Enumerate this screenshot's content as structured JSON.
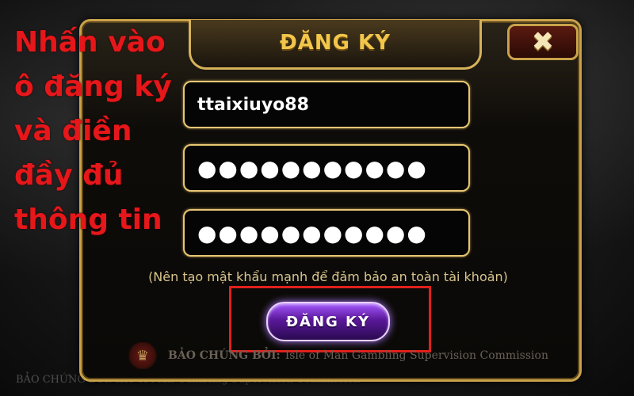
{
  "modal": {
    "title": "ĐĂNG KÝ",
    "close_icon": "close-icon"
  },
  "form": {
    "username_value": "ttaixiuyo88",
    "password_mask": "●●●●●●●●●●●",
    "confirm_mask": "●●●●●●●●●●●",
    "hint": "(Nên tạo mật khẩu mạnh để đảm bảo an toàn tài khoản)",
    "submit_label": "ĐĂNG KÝ"
  },
  "footer": {
    "brand": "BẢO CHỨNG BỞI:",
    "commission": "Isle of Man Gambling Supervision Commission"
  },
  "background": {
    "bottom_text": "BẢO CHỨNG BỞI: Isle of Man Gambling Supervision Commission"
  },
  "annotation": {
    "lines": [
      "Nhấn vào",
      "ô đăng ký",
      "và điền",
      "đầy đủ",
      "thông tin"
    ],
    "highlight_color": "#e0201c"
  },
  "colors": {
    "gold": "#c9a24a",
    "title": "#f2c64a",
    "button": "#a557ff",
    "annotation": "#e6171a"
  }
}
